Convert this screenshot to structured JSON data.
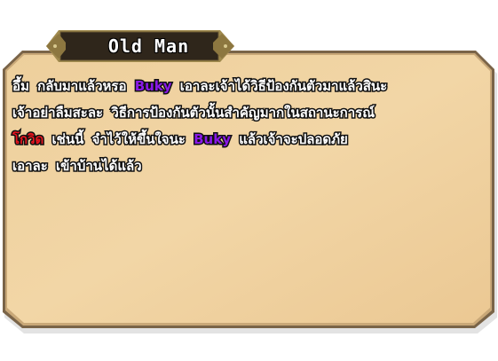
{
  "speaker": {
    "name": "Old Man"
  },
  "colors": {
    "panel": "#f0d3a2",
    "panel_border": "#7a6448",
    "nameplate": "#2f261b",
    "nameplate_trim": "#a08a4e",
    "highlight_name": "#8a19e6",
    "highlight_danger": "#e8141e",
    "text": "#ffffff"
  },
  "dialog": {
    "lines": [
      [
        {
          "text": "อึ้ม กลับมาแล้วหรอ ",
          "color": "white"
        },
        {
          "text": "Buky",
          "color": "purple"
        },
        {
          "text": " เอาละเจ้าได้วิธีป้องกันตัวมาแล้วสินะ",
          "color": "white"
        }
      ],
      [
        {
          "text": "เจ้าอย่าลืมสะละ วิธีการป้องกันตัวนั้นสำคัญมากในสถานะการณ์",
          "color": "white"
        }
      ],
      [
        {
          "text": "โกวิด",
          "color": "red"
        },
        {
          "text": " เช่นนี้ จำไว้ให้ขึ้นใจนะ ",
          "color": "white"
        },
        {
          "text": "Buky",
          "color": "purple"
        },
        {
          "text": " แล้วเจ้าจะปลอดภัย",
          "color": "white"
        }
      ],
      [
        {
          "text": "เอาละ เข้าบ้านได้แล้ว",
          "color": "white"
        }
      ]
    ]
  }
}
